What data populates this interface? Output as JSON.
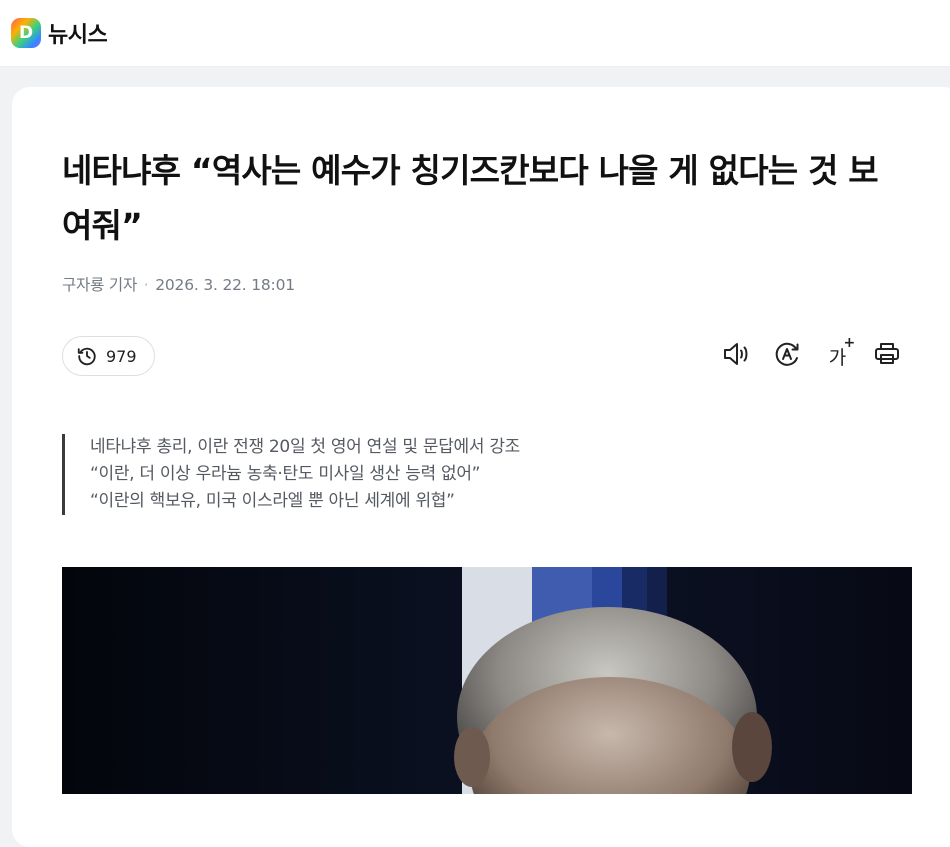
{
  "header": {
    "logo_letter": "D",
    "site_name": "뉴시스"
  },
  "article": {
    "title": "네타냐후 “역사는 예수가 칭기즈칸보다 나을 게 없다는 것 보여줘”",
    "reporter": "구자룡 기자",
    "separator": "·",
    "datetime": "2026. 3. 22. 18:01",
    "view_count": "979",
    "summary": [
      "네타냐후 총리, 이란 전쟁 20일 첫 영어 연설 및 문답에서 강조",
      "“이란, 더 이상 우라늄 농축·탄도 미사일 생산 능력 없어”",
      "“이란의 핵보유, 미국 이스라엘 뿐 아닌 세계에 위협”"
    ]
  },
  "toolbar": {
    "font_button_label": "가",
    "font_button_plus": "+",
    "icons": [
      "speaker-icon",
      "translate-icon",
      "font-size-icon",
      "print-icon"
    ]
  },
  "colors": {
    "accent_text": "#111111",
    "meta_text": "#757b84",
    "summary_text": "#555a61",
    "page_bg": "#f1f2f4"
  }
}
